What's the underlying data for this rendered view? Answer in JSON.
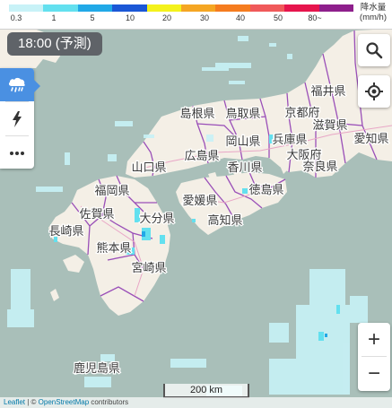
{
  "legend": {
    "colors": [
      "#c8f2f7",
      "#63e0ef",
      "#21a9e7",
      "#1b57d6",
      "#f4f21c",
      "#f5a623",
      "#f57c1f",
      "#f0595a",
      "#e6154d",
      "#8e1f8c"
    ],
    "ticks": [
      "0.3",
      "1",
      "5",
      "10",
      "20",
      "30",
      "40",
      "50",
      "80~"
    ],
    "unit_label": "降水量",
    "unit": "(mm/h)"
  },
  "time_label": "18:00 (予測)",
  "layers": {
    "rain_icon": "rain-cloud-icon",
    "lightning_icon": "lightning-icon",
    "more_icon": "more-dots-icon"
  },
  "map_labels": [
    "福井県",
    "島根県",
    "鳥取県",
    "京都府",
    "滋賀県",
    "愛知県",
    "岡山県",
    "兵庫県",
    "大阪府",
    "奈良県",
    "山口県",
    "広島県",
    "香川県",
    "徳島県",
    "福岡県",
    "愛媛県",
    "高知県",
    "佐賀県",
    "大分県",
    "長崎県",
    "熊本県",
    "宮崎県",
    "鹿児島県"
  ],
  "scale_label": "200 km",
  "attribution": {
    "leaflet": "Leaflet",
    "sep": " | © ",
    "osm": "OpenStreetMap",
    "suffix": " contributors"
  },
  "zoom": {
    "in": "+",
    "out": "−"
  },
  "colors": {
    "sea": "#a9bfb9",
    "land": "#f4efe6",
    "border": "#9a4fb8",
    "rain_light": "#c8f2f7",
    "rain_mid": "#63e0ef",
    "active": "#4a90e2"
  }
}
